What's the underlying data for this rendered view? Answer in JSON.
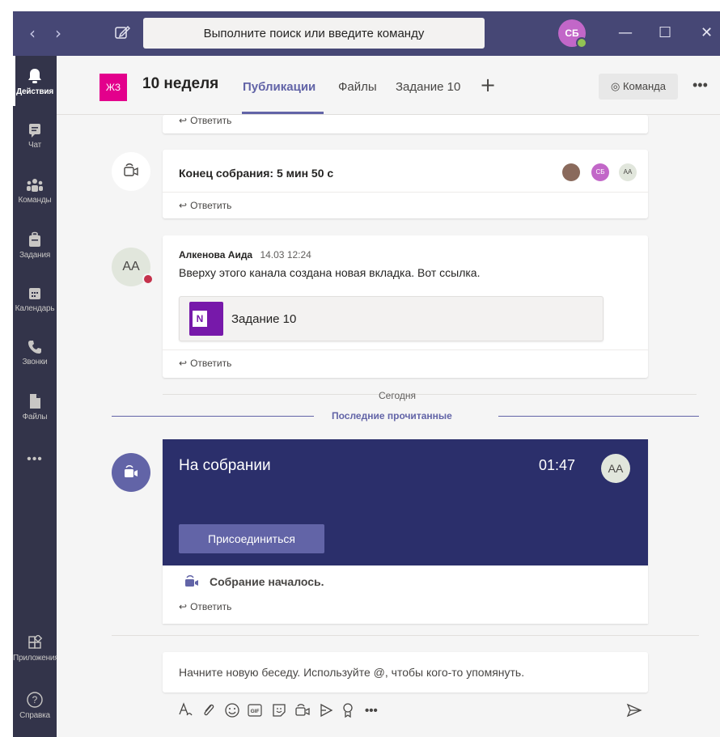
{
  "titlebar": {
    "search_placeholder": "Выполните поиск или введите команду",
    "user_initials": "СБ",
    "back_glyph": "‹",
    "forward_glyph": "›",
    "minimize_glyph": "—",
    "maximize_glyph": "☐",
    "close_glyph": "✕"
  },
  "rail": {
    "items": [
      {
        "label": "Действия",
        "icon": "bell-icon"
      },
      {
        "label": "Чат",
        "icon": "chat-icon"
      },
      {
        "label": "Команды",
        "icon": "teams-icon"
      },
      {
        "label": "Задания",
        "icon": "assignments-icon"
      },
      {
        "label": "Календарь",
        "icon": "calendar-icon"
      },
      {
        "label": "Звонки",
        "icon": "phone-icon"
      },
      {
        "label": "Файлы",
        "icon": "files-icon"
      },
      {
        "label": "•••",
        "icon": "more-icon"
      },
      {
        "label": "Приложения",
        "icon": "apps-icon"
      },
      {
        "label": "Справка",
        "icon": "help-icon"
      }
    ]
  },
  "channel": {
    "team_initials": "ЖЗ",
    "title": "10 неделя",
    "tabs": [
      "Публикации",
      "Файлы",
      "Задание 10"
    ],
    "add_tab_glyph": "+",
    "team_button": "◎ Команда",
    "more": "•••"
  },
  "feed": {
    "reply_label": "Ответить",
    "reply_arrow": "↩",
    "meeting_end": {
      "text": "Конец собрания: 5 мин 50 с",
      "participants": [
        "СБ",
        "АА"
      ]
    },
    "message": {
      "avatar_initials": "АА",
      "author": "Алкенова Аида",
      "time": "14.03 12:24",
      "text": "Вверху этого канала создана новая вкладка. Вот ссылка.",
      "attachment": "Задание 10",
      "attachment_logo": "N"
    },
    "date_separator": "Сегодня",
    "last_read": "Последние прочитанные",
    "live_meeting": {
      "title": "На собрании",
      "duration": "01:47",
      "avatar_initials": "АА",
      "join_button": "Присоединиться",
      "status": "Собрание началось."
    }
  },
  "composer": {
    "placeholder": "Начните новую беседу. Используйте @, чтобы кого-то упомянуть.",
    "tools": [
      "format",
      "attach",
      "emoji",
      "GIF",
      "sticker",
      "meet-now",
      "stream",
      "praise",
      "•••"
    ],
    "more_glyph": "•••"
  },
  "colors": {
    "titlebar": "#464775",
    "rail": "#33344a",
    "accent": "#6264a7",
    "meeting_banner": "#2b2f6b",
    "team_tile": "#e3008c"
  }
}
